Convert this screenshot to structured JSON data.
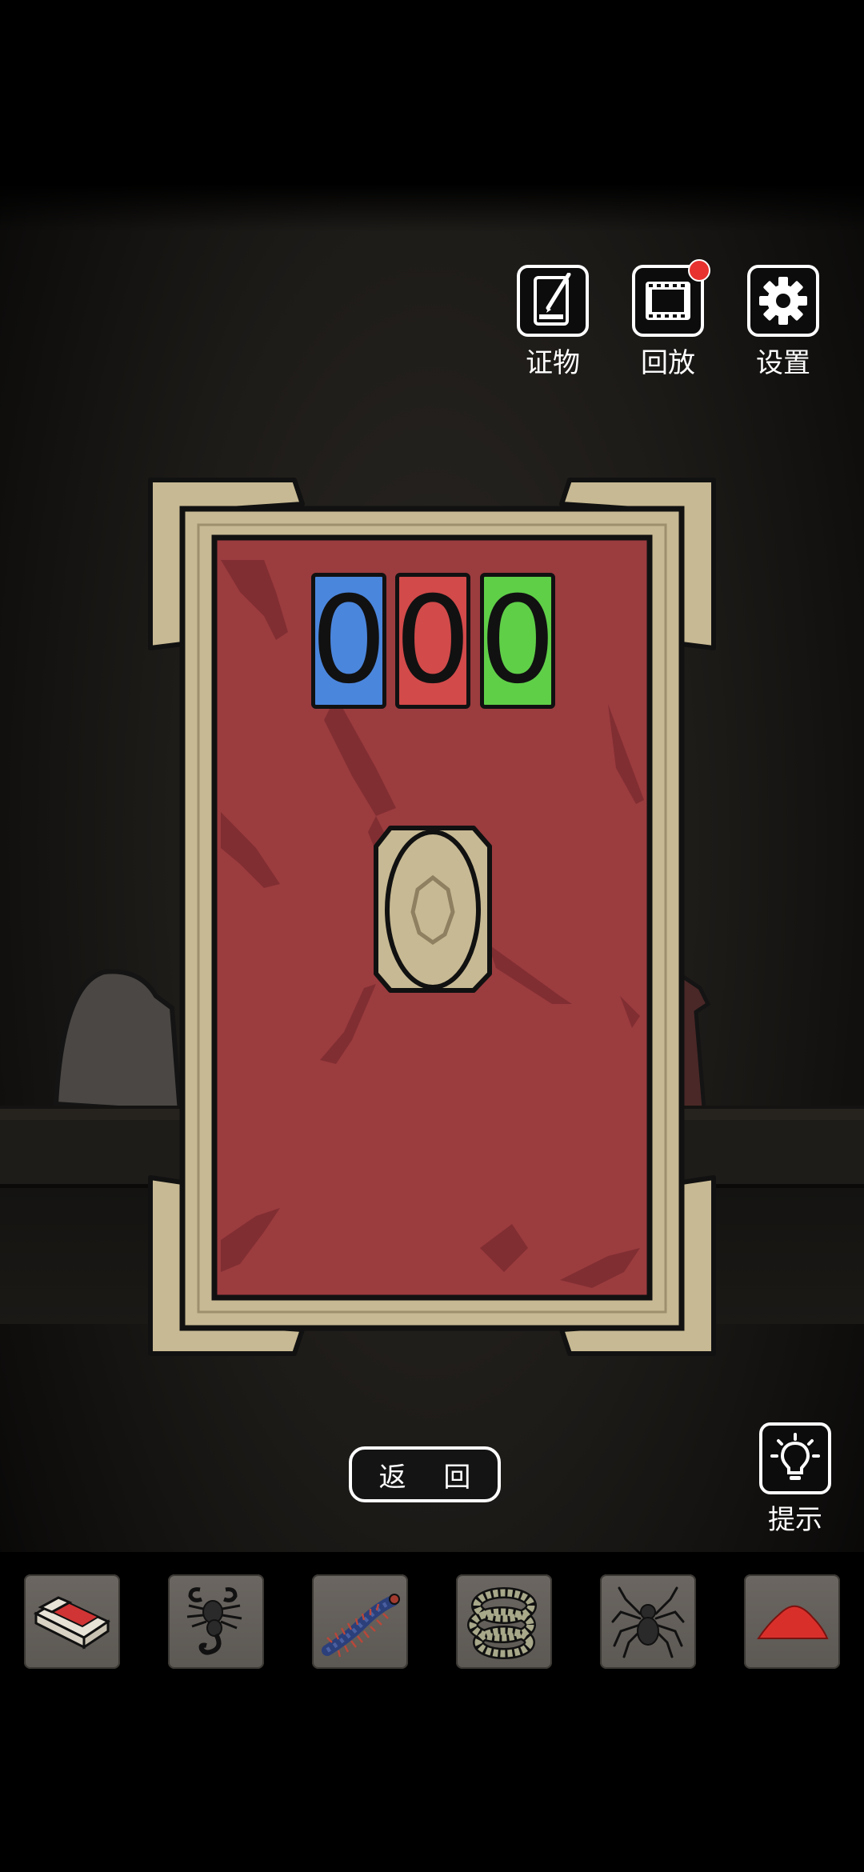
{
  "hud": {
    "evidence_label": "证物",
    "replay_label": "回放",
    "settings_label": "设置",
    "replay_has_notification": true
  },
  "puzzle": {
    "digits": [
      {
        "value": "0",
        "color": "#4b86dd"
      },
      {
        "value": "0",
        "color": "#d24a4a"
      },
      {
        "value": "0",
        "color": "#5fcf48"
      }
    ],
    "panel_color": "#9b3c3f",
    "frame_color": "#c7b993"
  },
  "back_label": "返 回",
  "hint_label": "提示",
  "inventory": [
    {
      "name": "matchbox",
      "icon": "matchbox-icon"
    },
    {
      "name": "scorpion",
      "icon": "scorpion-icon"
    },
    {
      "name": "centipede",
      "icon": "centipede-icon"
    },
    {
      "name": "snake",
      "icon": "snake-icon"
    },
    {
      "name": "spider",
      "icon": "spider-icon"
    },
    {
      "name": "red powder",
      "icon": "red-powder-icon"
    }
  ]
}
